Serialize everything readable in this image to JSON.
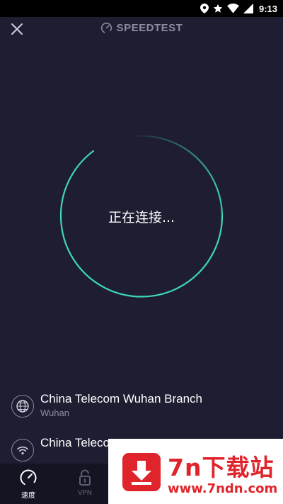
{
  "status_bar": {
    "time": "9:13"
  },
  "header": {
    "title": "SPEEDTEST"
  },
  "ring": {
    "label": "正在连接..."
  },
  "server": {
    "provider": "China Telecom Wuhan Branch",
    "city": "Wuhan"
  },
  "network": {
    "name": "China Telecom"
  },
  "nav": {
    "items": [
      {
        "label": "速度"
      },
      {
        "label": "VPN"
      }
    ]
  },
  "watermark": {
    "title": "7n下载站",
    "url": "www.7ndn.com"
  },
  "colors": {
    "background": "#1e1d31",
    "accent": "#3ed6bb",
    "nav_background": "#141423",
    "watermark_red": "#e0242b"
  }
}
